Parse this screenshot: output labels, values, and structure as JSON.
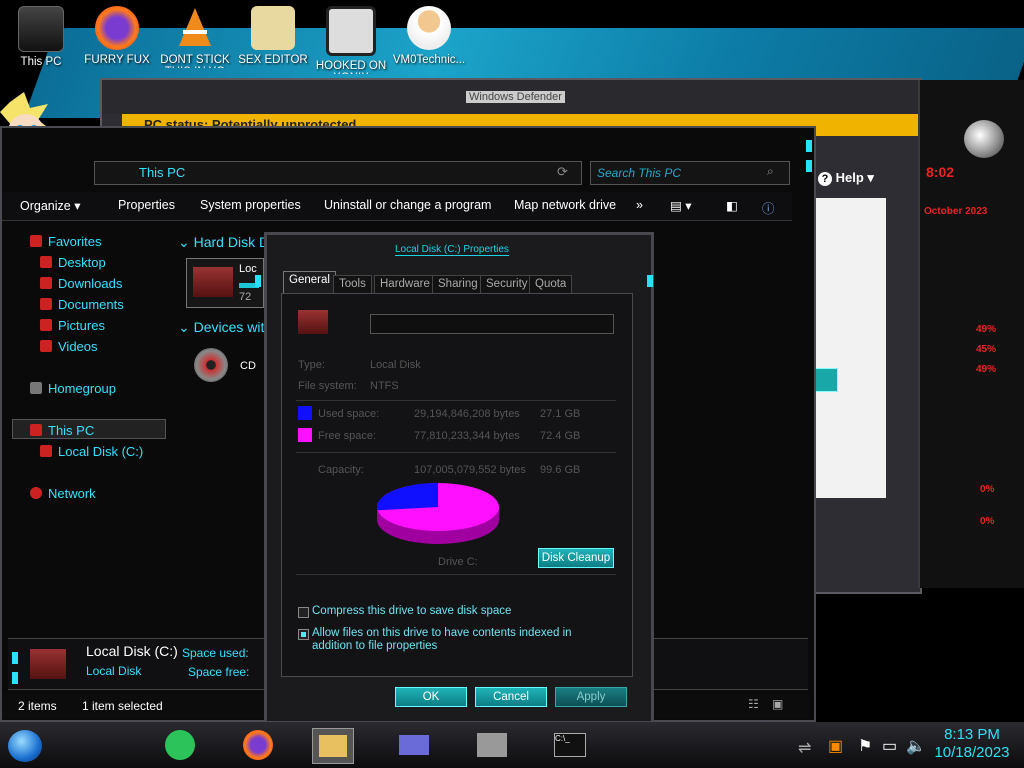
{
  "desktop": {
    "icons": [
      {
        "label": "This PC"
      },
      {
        "label": "FURRY FUX"
      },
      {
        "label": "DONT STICK THIS IN YO"
      },
      {
        "label": "SEX EDITOR"
      },
      {
        "label": "HOOKED ON XONIX"
      },
      {
        "label": "VM0Technic..."
      }
    ]
  },
  "defender": {
    "title": "Windows Defender",
    "status": "PC status: Potentially unprotected",
    "help_label": "Help"
  },
  "sidebar": {
    "time": "8:02",
    "date": "October 2023",
    "pct1": "49%",
    "pct2": "45%",
    "pct3": "49%",
    "pct4": "0%",
    "pct5": "0%"
  },
  "explorer": {
    "address": "This PC",
    "search_placeholder": "Search This PC",
    "toolbar": [
      "Organize",
      "Properties",
      "System properties",
      "Uninstall or change a program",
      "Map network drive",
      "»"
    ],
    "nav": {
      "favorites": "Favorites",
      "desktop": "Desktop",
      "downloads": "Downloads",
      "documents": "Documents",
      "pictures": "Pictures",
      "videos": "Videos",
      "homegroup": "Homegroup",
      "this_pc": "This PC",
      "local_disk": "Local Disk (C:)",
      "network": "Network"
    },
    "content": {
      "hard_disk_header": "Hard Disk Drives",
      "devices_header": "Devices with Removable Storage",
      "drive_label": "Loc",
      "drive_free": "72",
      "cd_label": "CD"
    },
    "details": {
      "name": "Local Disk (C:)",
      "type": "Local Disk",
      "space_used_label": "Space used:",
      "space_free_label": "Space free:"
    },
    "status": {
      "items": "2 items",
      "selected": "1 item selected"
    }
  },
  "properties": {
    "title": "Local Disk (C:) Properties",
    "tabs": [
      "General",
      "Tools",
      "Hardware",
      "Sharing",
      "Security",
      "Quota"
    ],
    "type_label": "Type:",
    "type_value": "Local Disk",
    "fs_label": "File system:",
    "fs_value": "NTFS",
    "used_label": "Used space:",
    "used_bytes": "29,194,846,208 bytes",
    "used_gb": "27.1 GB",
    "free_label": "Free space:",
    "free_bytes": "77,810,233,344 bytes",
    "free_gb": "72.4 GB",
    "capacity_label": "Capacity:",
    "capacity_bytes": "107,005,079,552 bytes",
    "capacity_gb": "99.6 GB",
    "drive_caption": "Drive C:",
    "cleanup_button": "Disk Cleanup",
    "compress_label": "Compress this drive to save disk space",
    "index_label": "Allow files on this drive to have contents indexed in addition to file properties",
    "ok": "OK",
    "cancel": "Cancel",
    "apply": "Apply",
    "used_fraction": 0.272,
    "colors": {
      "used": "#1010ff",
      "free": "#ff10ff"
    }
  },
  "taskbar": {
    "time": "8:13 PM",
    "date": "10/18/2023"
  }
}
